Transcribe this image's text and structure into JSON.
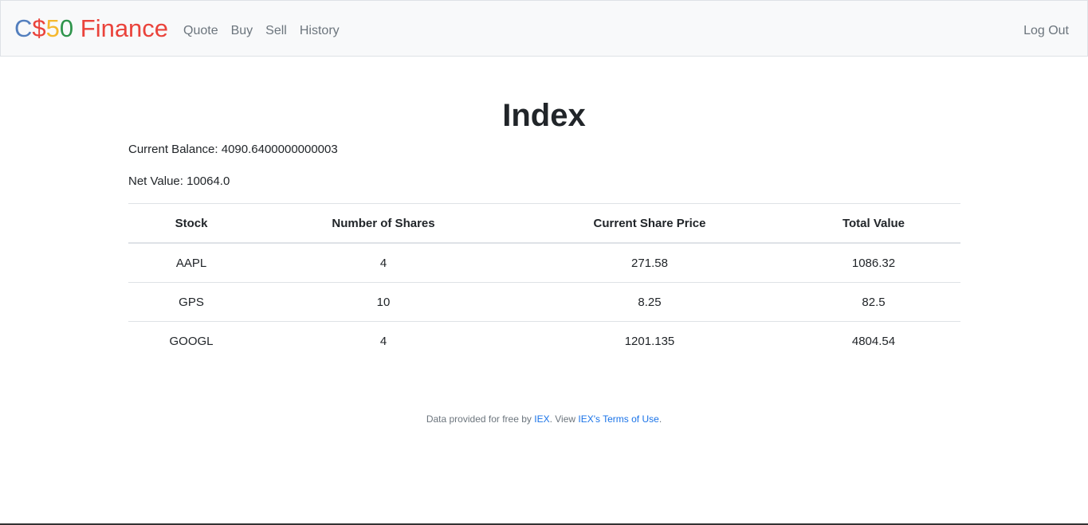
{
  "brand": {
    "c": "C",
    "dollar": "$",
    "five": "5",
    "zero": "0",
    "finance": " Finance"
  },
  "nav": {
    "items": [
      {
        "label": "Quote"
      },
      {
        "label": "Buy"
      },
      {
        "label": "Sell"
      },
      {
        "label": "History"
      }
    ],
    "logout": "Log Out"
  },
  "main": {
    "title": "Index",
    "balance": "Current Balance: 4090.6400000000003",
    "net_value": "Net Value: 10064.0"
  },
  "table": {
    "headers": [
      "Stock",
      "Number of Shares",
      "Current Share Price",
      "Total Value"
    ],
    "rows": [
      [
        "AAPL",
        "4",
        "271.58",
        "1086.32"
      ],
      [
        "GPS",
        "10",
        "8.25",
        "82.5"
      ],
      [
        "GOOGL",
        "4",
        "1201.135",
        "4804.54"
      ]
    ]
  },
  "footer": {
    "prefix": "Data provided for free by ",
    "iex_link": "IEX",
    "middle": ". View ",
    "terms_link": "IEX's Terms of Use",
    "suffix": "."
  },
  "colors": {
    "brand_blue": "#537fbe",
    "brand_red": "#ea433b",
    "brand_yellow": "#f5b82e",
    "brand_green": "#2e944b",
    "link": "#1a73e8"
  }
}
